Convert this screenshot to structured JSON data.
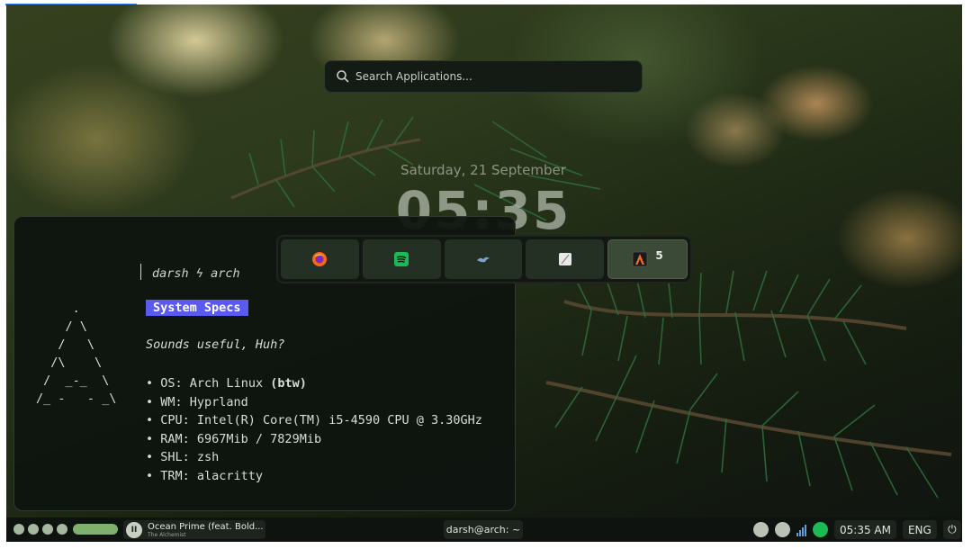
{
  "search": {
    "placeholder": "Search Applications..."
  },
  "clock": {
    "date": "Saturday, 21 September",
    "time": "05:35"
  },
  "terminal": {
    "prompt_user": "darsh",
    "prompt_sep": "ϟ",
    "prompt_host": "arch",
    "badge": "System Specs",
    "tagline": "Sounds useful, Huh?",
    "logo": "     .\n    / \\\n   /   \\\n  /\\    \\\n /  _-_  \\\n/_ -   - _\\",
    "specs": {
      "os_label": "OS:",
      "os_value": "Arch Linux",
      "os_suffix": "(btw)",
      "wm": "WM: Hyprland",
      "cpu": "CPU: Intel(R) Core(TM) i5-4590 CPU @ 3.30GHz",
      "ram": "RAM: 6967Mib / 7829Mib",
      "shl": "SHL: zsh",
      "trm": "TRM: alacritty"
    }
  },
  "dock": {
    "apps": [
      {
        "icon": "firefox-icon",
        "color": "#ff6611"
      },
      {
        "icon": "spotify-icon",
        "color": "#1db954"
      },
      {
        "icon": "bird-icon",
        "color": "#7fa3c8"
      },
      {
        "icon": "text-editor-icon",
        "color": "#e8e8e8"
      },
      {
        "icon": "alacritty-icon",
        "color": "#f06a2a",
        "count": "5"
      }
    ]
  },
  "taskbar": {
    "workspaces": 5,
    "music": {
      "title": "Ocean Prime (feat. Bold...",
      "artist": "The Alchemist",
      "button": "II"
    },
    "active_window": "darsh@arch: ~",
    "time": "05:35 AM",
    "lang": "ENG",
    "power_glyph": "⏻"
  },
  "colors": {
    "accent": "#5a59f0",
    "workspace_active": "#7fb06d"
  }
}
